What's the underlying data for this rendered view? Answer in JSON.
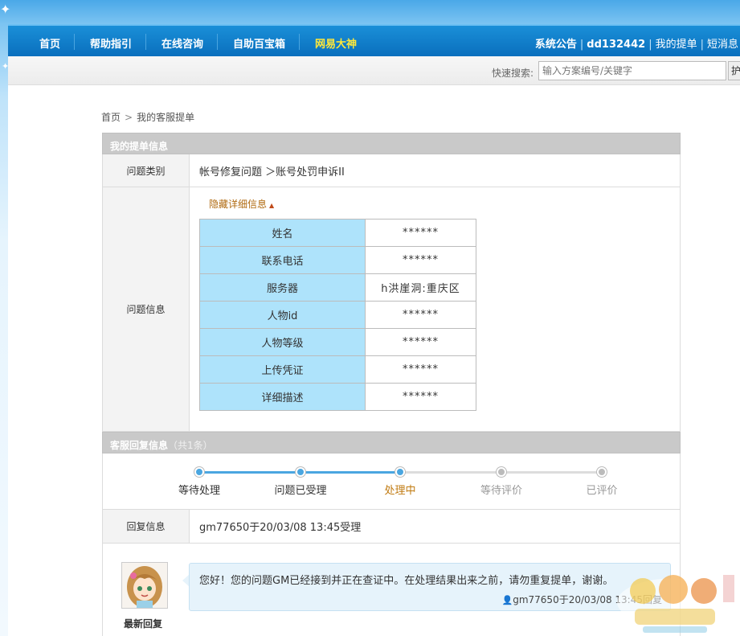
{
  "nav": {
    "items": [
      "首页",
      "帮助指引",
      "在线咨询",
      "自助百宝箱",
      "网易大神"
    ],
    "active_index": 4
  },
  "user_links": {
    "announcement": "系统公告",
    "username": "dd132442",
    "my_tickets": "我的提单",
    "messages": "短消息"
  },
  "search": {
    "label": "快速搜索:",
    "placeholder": "输入方案编号/关键字",
    "button": "护"
  },
  "breadcrumb": {
    "home": "首页",
    "arrow": ">",
    "current": "我的客服提单"
  },
  "ticket": {
    "header": "我的提单信息",
    "category_label": "问题类别",
    "category_value": "帐号修复问题 ＞账号处罚申诉II",
    "info_label": "问题信息",
    "toggle_text": "隐藏详细信息",
    "details": [
      {
        "key": "姓名",
        "value": "******"
      },
      {
        "key": "联系电话",
        "value": "******"
      },
      {
        "key": "服务器",
        "value": "h洪崖洞:重庆区"
      },
      {
        "key": "人物id",
        "value": "******"
      },
      {
        "key": "人物等级",
        "value": "******"
      },
      {
        "key": "上传凭证",
        "value": "******"
      },
      {
        "key": "详细描述",
        "value": "******"
      }
    ]
  },
  "reply": {
    "header": "客服回复信息",
    "header_count": "（共1条）",
    "steps": [
      {
        "label": "等待处理",
        "state": "done"
      },
      {
        "label": "问题已受理",
        "state": "done"
      },
      {
        "label": "处理中",
        "state": "current"
      },
      {
        "label": "等待评价",
        "state": "todo"
      },
      {
        "label": "已评价",
        "state": "todo"
      }
    ],
    "reply_label": "回复信息",
    "reply_value": "gm77650于20/03/08 13:45受理",
    "latest_label": "最新回复",
    "message": "您好！您的问题GM已经接到并正在查证中。在处理结果出来之前，请勿重复提单，谢谢。",
    "message_meta": "gm77650于20/03/08 13:45回复"
  },
  "colors": {
    "nav_bg": "#0a7ac6",
    "nav_active": "#ffe83a",
    "step_done": "#4aa6e0",
    "step_current_text": "#c07a10",
    "step_todo": "#bbbbbb",
    "detail_key_bg": "#aee3fb"
  }
}
